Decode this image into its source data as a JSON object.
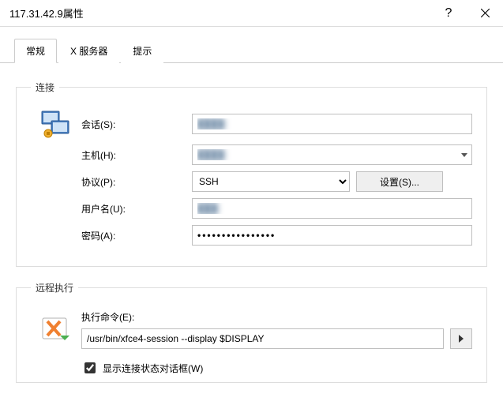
{
  "window": {
    "title": "117.31.42.9属性"
  },
  "tabs": {
    "general": "常规",
    "xserver": "X 服务器",
    "tips": "提示"
  },
  "connection": {
    "legend": "连接",
    "session_label": "会话(S):",
    "session_value": "████",
    "host_label": "主机(H):",
    "host_value": "████",
    "protocol_label": "协议(P):",
    "protocol_value": "SSH",
    "settings_button": "设置(S)...",
    "username_label": "用户名(U):",
    "username_value": "███",
    "password_label": "密码(A):",
    "password_value": "••••••••••••••••"
  },
  "remote_exec": {
    "legend": "远程执行",
    "command_label": "执行命令(E):",
    "command_value": "/usr/bin/xfce4-session --display $DISPLAY",
    "show_status_label": "显示连接状态对话框(W)",
    "show_status_checked": true
  }
}
